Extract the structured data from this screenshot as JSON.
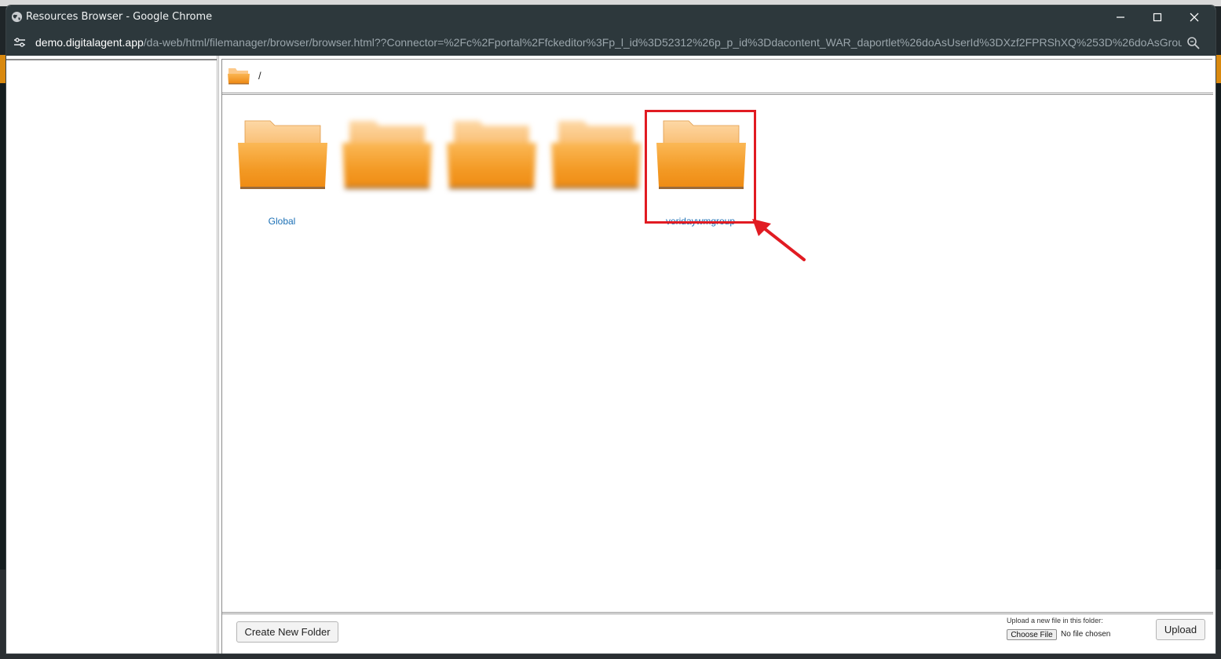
{
  "window": {
    "title": "Resources Browser - Google Chrome",
    "url_host": "demo.digitalagent.app",
    "url_path": "/da-web/html/filemanager/browser/browser.html??Connector=%2Fc%2Fportal%2Ffckeditor%3Fp_l_id%3D52312%26p_p_id%3Ddacontent_WAR_daportlet%26doAsUserId%3DXzf2FPRShXQ%253D%26doAsGroupI..."
  },
  "breadcrumb": {
    "path": "/"
  },
  "folders": [
    {
      "label": "Global",
      "blurred": false
    },
    {
      "label": "",
      "blurred": true
    },
    {
      "label": "",
      "blurred": true
    },
    {
      "label": "",
      "blurred": true
    },
    {
      "label": "veridaywmgroup",
      "blurred": false,
      "highlighted": true
    }
  ],
  "footer": {
    "create_folder_label": "Create New Folder",
    "upload_hint": "Upload a new file in this folder:",
    "choose_file_label": "Choose File",
    "no_file_text": "No file chosen",
    "upload_label": "Upload"
  },
  "colors": {
    "titlebar": "#2d383c",
    "folder_orange": "#f4a030",
    "link_blue": "#1a6fb5",
    "highlight_red": "#e11b22"
  }
}
